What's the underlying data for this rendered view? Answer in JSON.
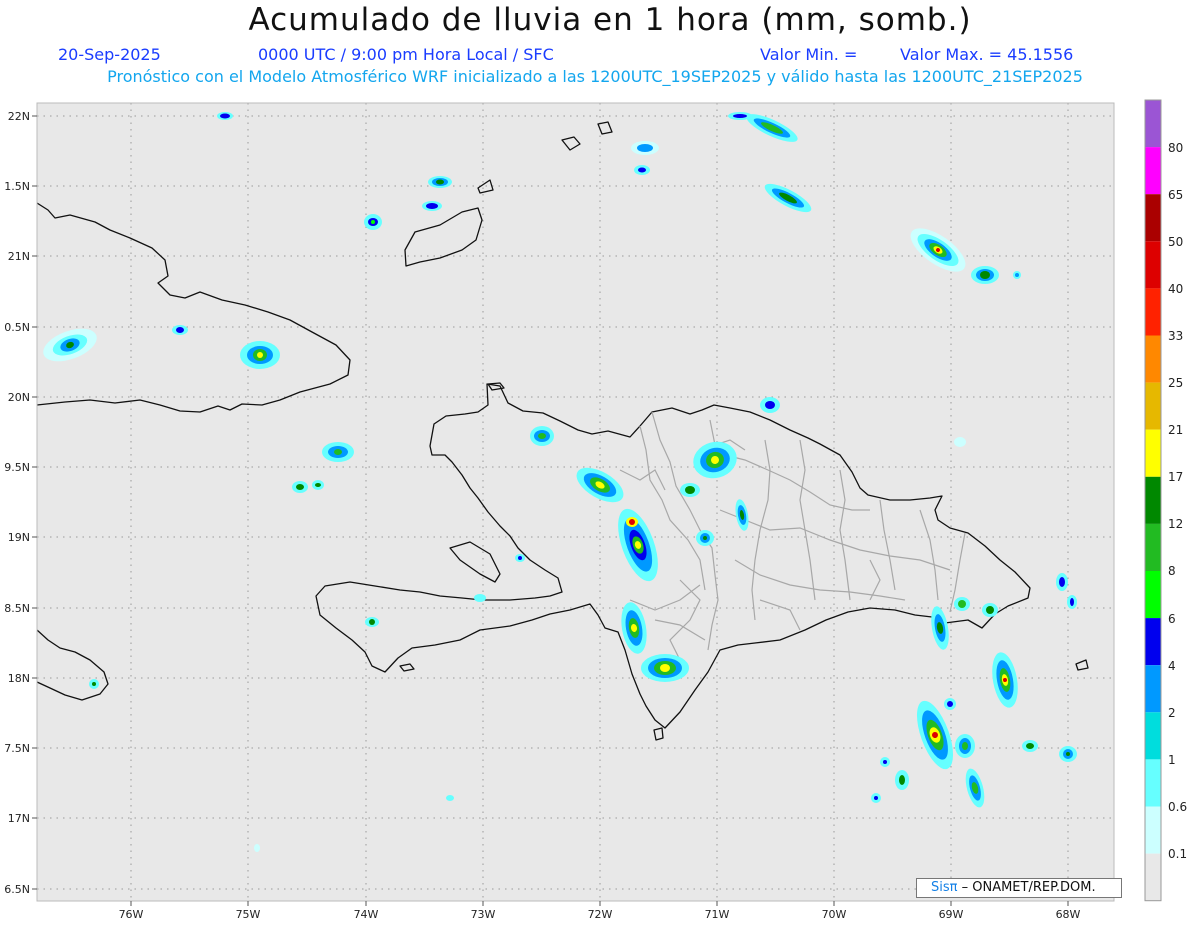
{
  "header": {
    "title": "Acumulado de lluvia en 1 hora (mm, somb.)",
    "date": "20-Sep-2025",
    "time": "0000 UTC / 9:00 pm Hora Local / SFC",
    "min_label": "Valor Min. =",
    "max_label": "Valor Max. = 45.1556",
    "model_info": "Pronóstico con el Modelo Atmosférico WRF inicializado a las 1200UTC_19SEP2025 y válido hasta las  1200UTC_21SEP2025"
  },
  "axes": {
    "lon_ticks": [
      "76W",
      "75W",
      "74W",
      "73W",
      "72W",
      "71W",
      "70W",
      "69W",
      "68W"
    ],
    "lat_ticks": [
      "22N",
      "1.5N",
      "21N",
      "0.5N",
      "20N",
      "9.5N",
      "19N",
      "8.5N",
      "18N",
      "7.5N",
      "17N",
      "6.5N"
    ]
  },
  "colorbar": {
    "labels": [
      "80",
      "65",
      "50",
      "40",
      "33",
      "25",
      "21",
      "17",
      "12",
      "8",
      "6",
      "4",
      "2",
      "1",
      "0.6",
      "0.1"
    ],
    "colors": [
      "#9b55d4",
      "#ff00ff",
      "#aa0000",
      "#dd0000",
      "#ff2200",
      "#ff8800",
      "#e6b800",
      "#ffff00",
      "#008800",
      "#22bb22",
      "#00ff00",
      "#0000ee",
      "#0099ff",
      "#00dddd",
      "#66ffff",
      "#ccffff",
      "#e8e8e8"
    ]
  },
  "credit": {
    "sis": "Sisπ",
    "text": " – ONAMET/REP.DOM."
  }
}
